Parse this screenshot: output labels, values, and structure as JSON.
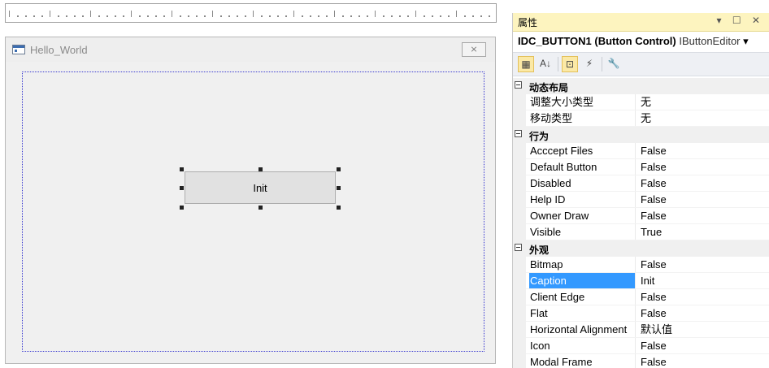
{
  "ruler": {},
  "dialog": {
    "title": "Hello_World",
    "close_glyph": "⨯",
    "button_caption": "Init"
  },
  "properties": {
    "header_title": "属性",
    "header_controls": "▾ ☐ ✕",
    "object_name": "IDC_BUTTON1 (Button Control)",
    "object_type": "IButtonEditor",
    "object_dropdown": "▾",
    "toolbar": [
      {
        "name": "categorized-icon",
        "glyph": "▦",
        "active": true
      },
      {
        "name": "alphabetical-icon",
        "glyph": "A↓",
        "active": false
      },
      {
        "name": "properties-icon",
        "glyph": "⊡",
        "active": true
      },
      {
        "name": "events-icon",
        "glyph": "⚡",
        "active": false
      },
      {
        "name": "property-pages-icon",
        "glyph": "🔧",
        "active": false
      }
    ],
    "categories": [
      {
        "label": "动态布局",
        "rows": [
          {
            "name": "调整大小类型",
            "value": "无"
          },
          {
            "name": "移动类型",
            "value": "无"
          }
        ]
      },
      {
        "label": "行为",
        "rows": [
          {
            "name": "Acccept Files",
            "value": "False"
          },
          {
            "name": "Default Button",
            "value": "False"
          },
          {
            "name": "Disabled",
            "value": "False"
          },
          {
            "name": "Help ID",
            "value": "False"
          },
          {
            "name": "Owner Draw",
            "value": "False"
          },
          {
            "name": "Visible",
            "value": "True"
          }
        ]
      },
      {
        "label": "外观",
        "rows": [
          {
            "name": "Bitmap",
            "value": "False"
          },
          {
            "name": "Caption",
            "value": "Init",
            "selected": true
          },
          {
            "name": "Client Edge",
            "value": "False"
          },
          {
            "name": "Flat",
            "value": "False"
          },
          {
            "name": "Horizontal Alignment",
            "value": "默认值"
          },
          {
            "name": "Icon",
            "value": "False"
          },
          {
            "name": "Modal Frame",
            "value": "False"
          }
        ]
      }
    ]
  }
}
